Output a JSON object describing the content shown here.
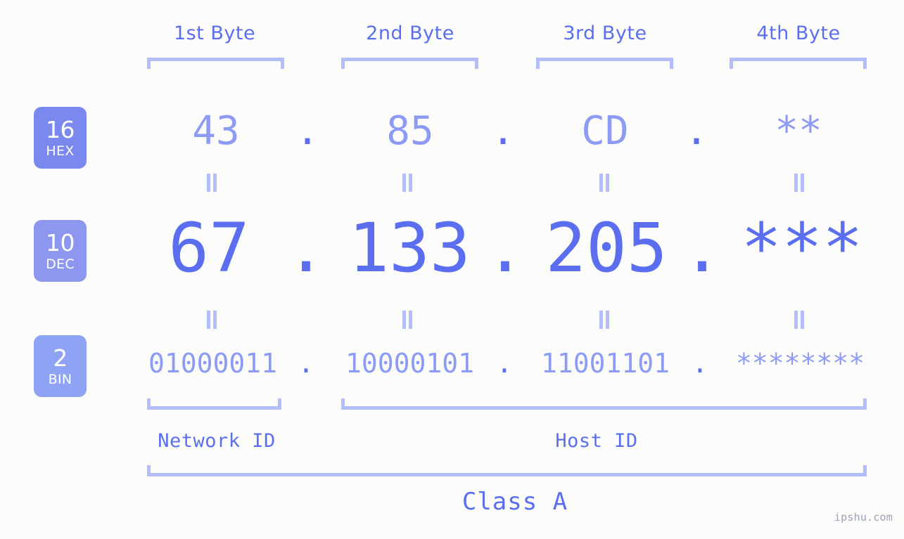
{
  "site": {
    "watermark": "ipshu.com"
  },
  "byte_headers": [
    {
      "label": "1st Byte"
    },
    {
      "label": "2nd Byte"
    },
    {
      "label": "3rd Byte"
    },
    {
      "label": "4th Byte"
    }
  ],
  "bases": [
    {
      "number": "16",
      "name": "HEX",
      "color": "#7b88ed"
    },
    {
      "number": "10",
      "name": "DEC",
      "color": "#8d97f0"
    },
    {
      "number": "2",
      "name": "BIN",
      "color": "#8fa3f5"
    }
  ],
  "separator": ".",
  "rows": {
    "hex": {
      "base": "16",
      "name": "HEX",
      "values": [
        "43",
        "85",
        "CD",
        "**"
      ]
    },
    "dec": {
      "base": "10",
      "name": "DEC",
      "values": [
        "67",
        "133",
        "205",
        "***"
      ]
    },
    "bin": {
      "base": "2",
      "name": "BIN",
      "values": [
        "01000011",
        "10000101",
        "11001101",
        "********"
      ]
    }
  },
  "sections": [
    {
      "label": "Network ID"
    },
    {
      "label": "Host ID"
    }
  ],
  "class": {
    "label": "Class A"
  },
  "colors": {
    "background": "#fcfdfa",
    "accent_strong": "#5b6ef0",
    "accent_mid": "#8d9bf5",
    "accent_light": "#b3bdfb",
    "watermark": "#9aa3b8"
  }
}
